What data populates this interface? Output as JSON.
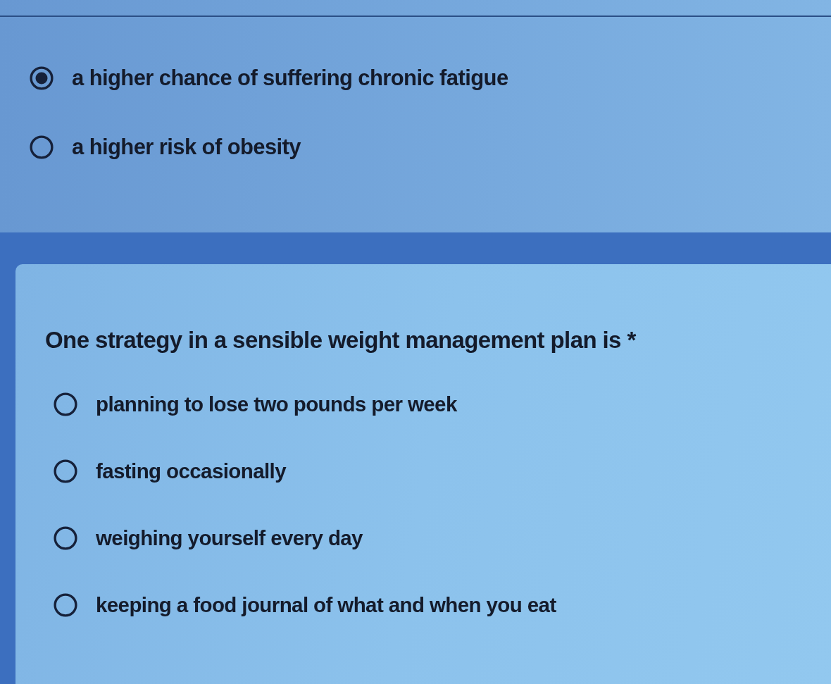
{
  "questions": [
    {
      "options": [
        {
          "label": "a higher chance of suffering chronic fatigue",
          "selected": true
        },
        {
          "label": "a higher risk of obesity",
          "selected": false
        }
      ]
    },
    {
      "title": "One strategy in a sensible weight management plan is *",
      "options": [
        {
          "label": "planning to lose two pounds per week",
          "selected": false
        },
        {
          "label": "fasting occasionally",
          "selected": false
        },
        {
          "label": "weighing yourself every day",
          "selected": false
        },
        {
          "label": "keeping a food journal of what and when you eat",
          "selected": false
        }
      ]
    }
  ]
}
